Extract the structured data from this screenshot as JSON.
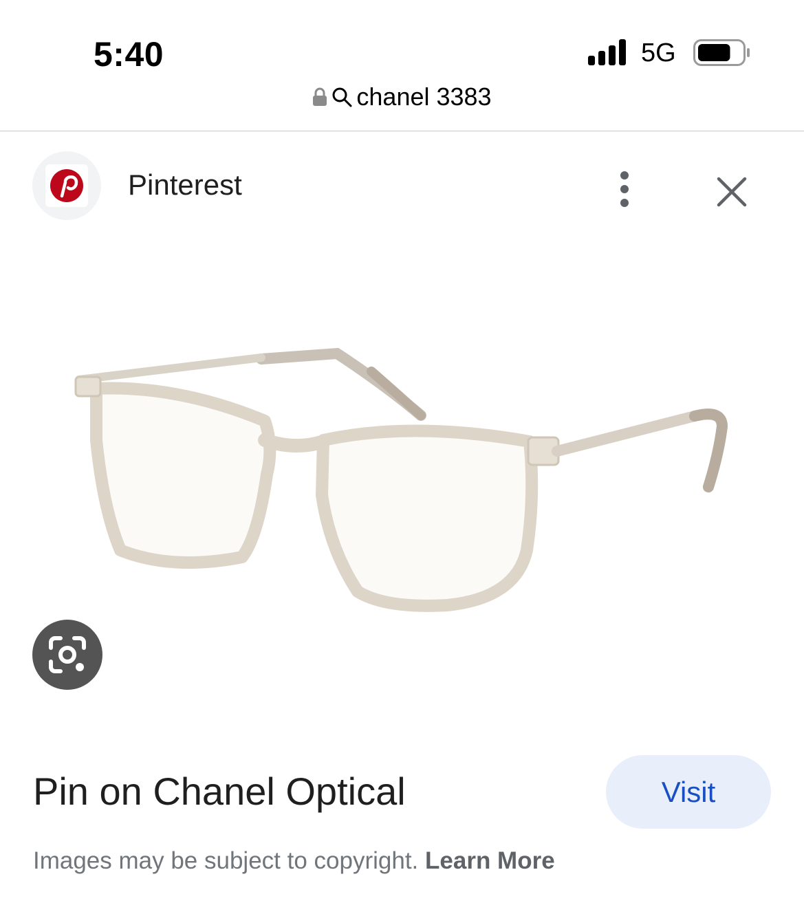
{
  "status_bar": {
    "time": "5:40",
    "network": "5G",
    "battery_level": 0.75
  },
  "url_bar": {
    "query": "chanel 3383",
    "lock_icon": "lock-icon",
    "search_icon": "search-icon"
  },
  "source": {
    "name": "Pinterest",
    "logo_color": "#bd081c"
  },
  "image": {
    "subject": "glasses"
  },
  "result": {
    "title": "Pin on Chanel Optical",
    "visit_label": "Visit",
    "copyright_text": "Images may be subject to copyright.",
    "learn_more_label": "Learn More"
  },
  "colors": {
    "accent": "#1a4fc4",
    "visit_bg": "#e8effb",
    "lens_button_bg": "#545454"
  }
}
